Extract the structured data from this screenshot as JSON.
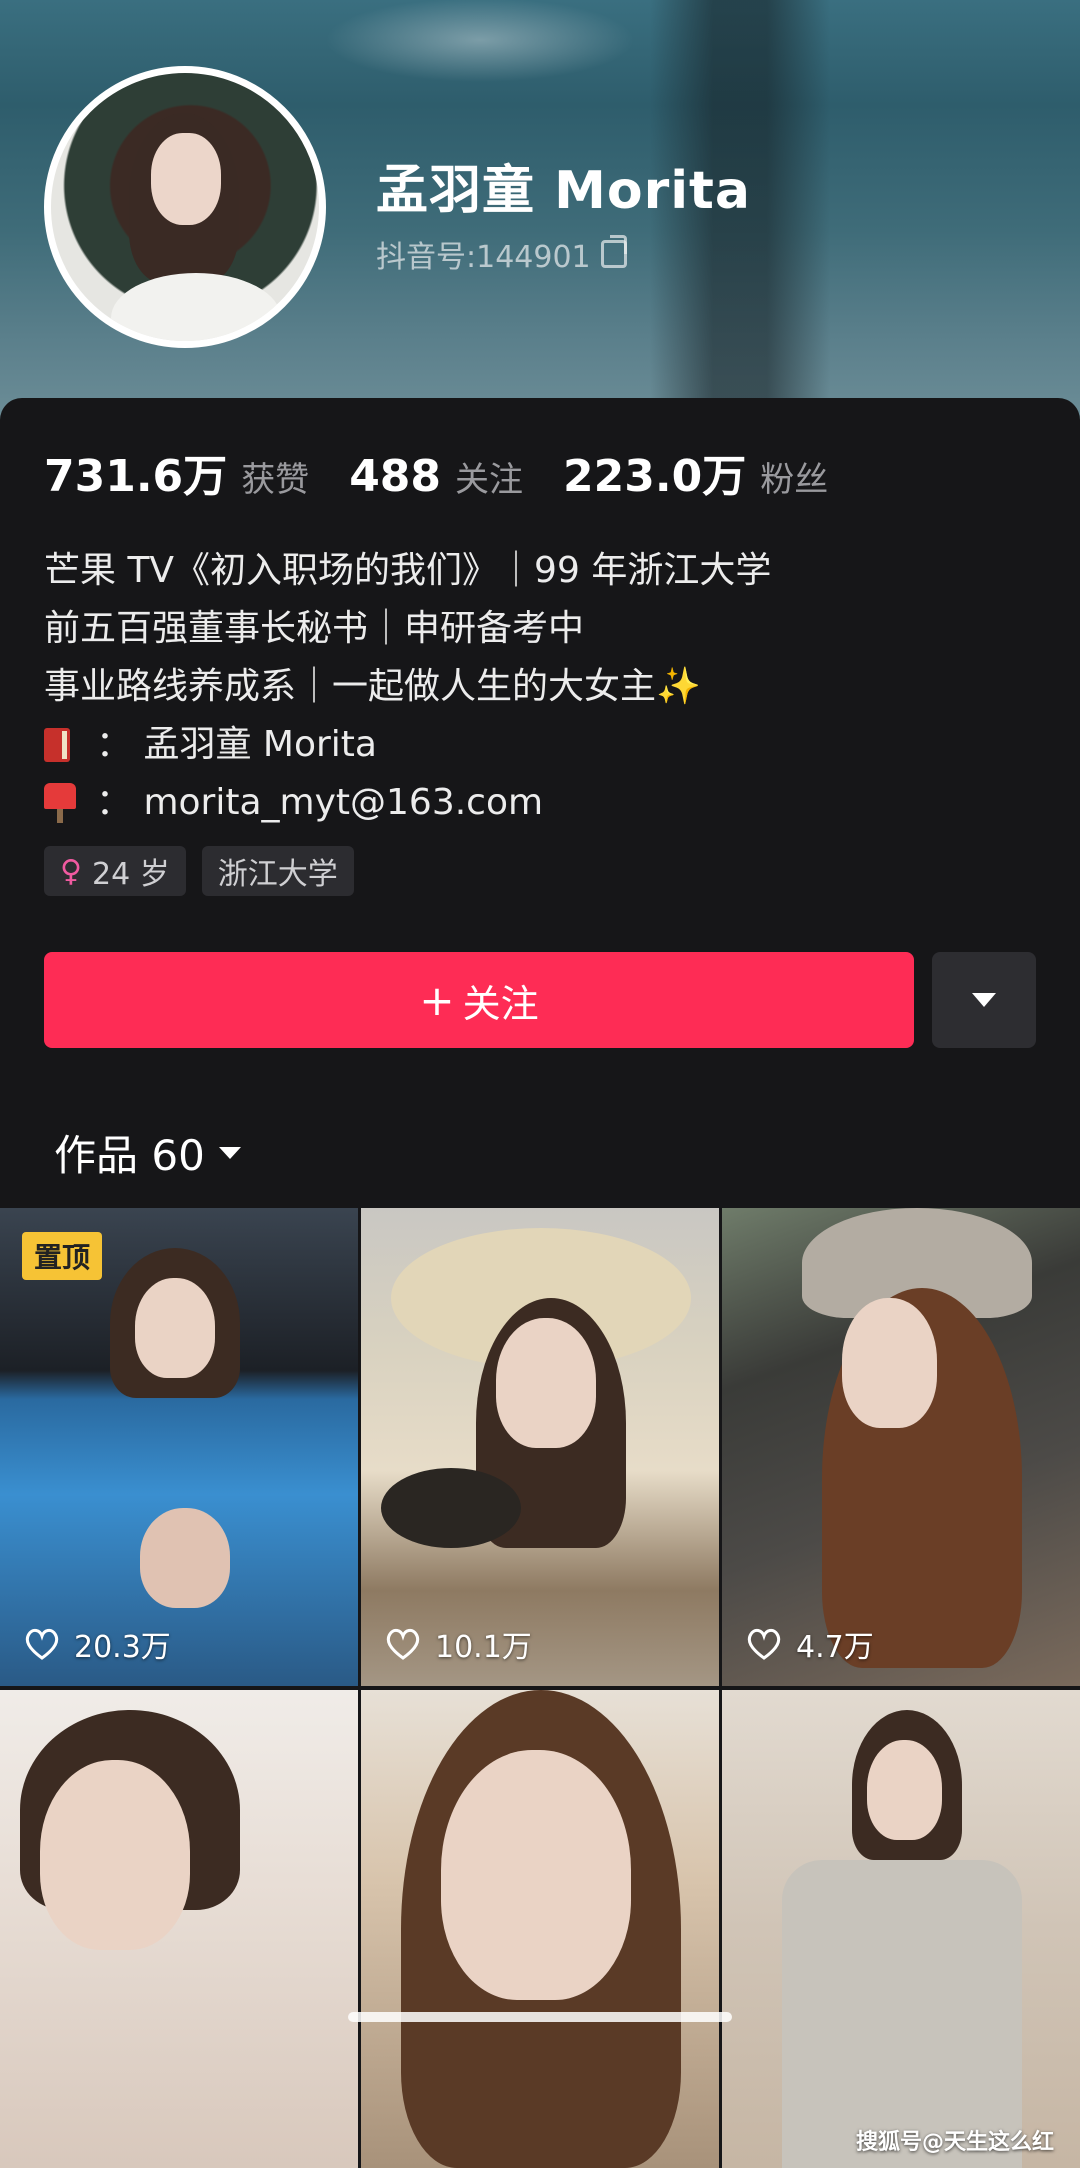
{
  "profile": {
    "name": "孟羽童 Morita",
    "douyin_id": "抖音号:144901"
  },
  "stats": [
    {
      "value": "731.6万",
      "label": "获赞"
    },
    {
      "value": "488",
      "label": "关注"
    },
    {
      "value": "223.0万",
      "label": "粉丝"
    }
  ],
  "bio": {
    "line1": "芒果 TV《初入职场的我们》｜99 年浙江大学",
    "line2": "前五百强董事长秘书｜申研备考中",
    "line3": "事业路线养成系｜一起做人生的大女主",
    "line3_emoji": "✨",
    "line4": "：  孟羽童 Morita",
    "line5": "：  morita_myt@163.com"
  },
  "tags": {
    "age": "24 岁",
    "school": "浙江大学"
  },
  "actions": {
    "follow_label": "关注",
    "follow_plus": "+"
  },
  "works": {
    "label": "作品 60"
  },
  "videos": [
    {
      "pinned_label": "置顶",
      "likes": "20.3万"
    },
    {
      "likes": "10.1万"
    },
    {
      "likes": "4.7万"
    },
    {},
    {},
    {}
  ],
  "watermark": "搜狐号@天生这么红",
  "colors": {
    "accent": "#fe2c55",
    "background": "#161618",
    "pin_badge": "#f6c335"
  }
}
